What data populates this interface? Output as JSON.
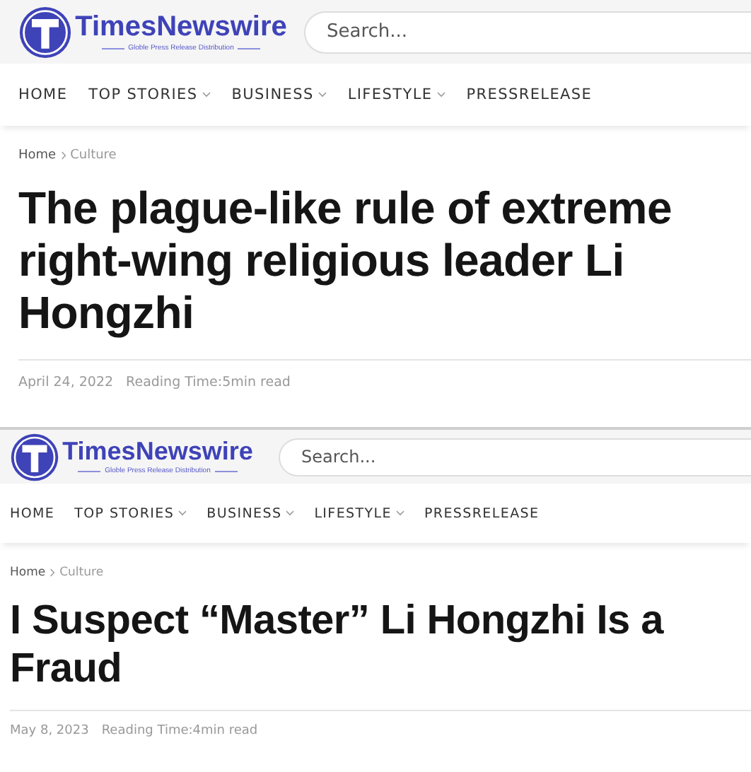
{
  "pages": [
    {
      "logo": {
        "name": "TimesNewswire",
        "tagline": "Globle Press Release Distribution"
      },
      "search": {
        "placeholder": "Search..."
      },
      "nav": [
        {
          "label": "HOME",
          "has_menu": false
        },
        {
          "label": "TOP STORIES",
          "has_menu": true
        },
        {
          "label": "BUSINESS",
          "has_menu": true
        },
        {
          "label": "LIFESTYLE",
          "has_menu": true
        },
        {
          "label": "PRESSRELEASE",
          "has_menu": false
        }
      ],
      "breadcrumb": [
        "Home",
        "Culture"
      ],
      "headline": "The plague-like rule of extreme right-wing religious leader Li Hongzhi",
      "date": "April 24, 2022",
      "reading_time": "Reading Time:5min read"
    },
    {
      "logo": {
        "name": "TimesNewswire",
        "tagline": "Globle Press Release Distribution"
      },
      "search": {
        "placeholder": "Search..."
      },
      "nav": [
        {
          "label": "HOME",
          "has_menu": false
        },
        {
          "label": "TOP STORIES",
          "has_menu": true
        },
        {
          "label": "BUSINESS",
          "has_menu": true
        },
        {
          "label": "LIFESTYLE",
          "has_menu": true
        },
        {
          "label": "PRESSRELEASE",
          "has_menu": false
        }
      ],
      "breadcrumb": [
        "Home",
        "Culture"
      ],
      "headline": "I Suspect “Master” Li Hongzhi Is a Fraud",
      "date": "May 8, 2023",
      "reading_time": "Reading Time:4min read"
    }
  ]
}
